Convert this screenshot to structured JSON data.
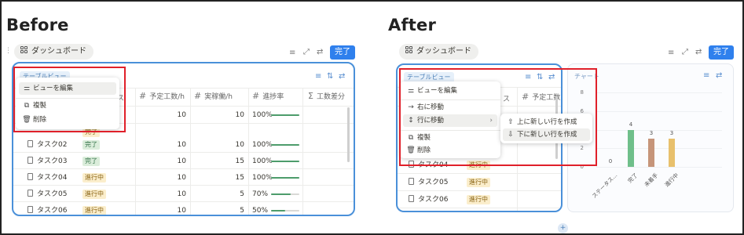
{
  "before": {
    "heading": "Before",
    "dashboard_label": "ダッシュボード",
    "done_label": "完了",
    "view_chip": "テーブルビュー",
    "columns": [
      "ス",
      "予定工数/h",
      "実稼働/h",
      "進捗率",
      "工数差分"
    ],
    "rows": [
      {
        "name": "タスク02",
        "status": "完了",
        "status_kind": "done",
        "planned": "10",
        "actual": "10",
        "progress_text": "100%",
        "progress": 1.0
      },
      {
        "name": "タスク03",
        "status": "完了",
        "status_kind": "done",
        "planned": "10",
        "actual": "15",
        "progress_text": "100%",
        "progress": 1.0
      },
      {
        "name": "タスク04",
        "status": "進行中",
        "status_kind": "prog",
        "planned": "10",
        "actual": "15",
        "progress_text": "100%",
        "progress": 1.0
      },
      {
        "name": "タスク05",
        "status": "進行中",
        "status_kind": "prog",
        "planned": "10",
        "actual": "5",
        "progress_text": "70%",
        "progress": 0.7
      },
      {
        "name": "タスク06",
        "status": "進行中",
        "status_kind": "prog",
        "planned": "10",
        "actual": "5",
        "progress_text": "50%",
        "progress": 0.5
      }
    ],
    "first_row_values": {
      "planned": "10",
      "actual": "10",
      "progress_text": "100%",
      "progress": 1.0
    },
    "menu": {
      "edit_view": "ビューを編集",
      "duplicate": "複製",
      "delete": "削除"
    }
  },
  "after": {
    "heading": "After",
    "dashboard_label": "ダッシュボード",
    "done_label": "完了",
    "view_chip": "テーブルビュー",
    "columns": [
      "ス",
      "予定工数"
    ],
    "rows": [
      {
        "name": "タスク04",
        "status": "進行中",
        "status_kind": "prog"
      },
      {
        "name": "タスク05",
        "status": "進行中",
        "status_kind": "prog"
      },
      {
        "name": "タスク06",
        "status": "進行中",
        "status_kind": "prog"
      }
    ],
    "menu": {
      "edit_view": "ビューを編集",
      "move_right": "右に移動",
      "move_row": "行に移動",
      "duplicate": "複製",
      "delete": "削除"
    },
    "submenu": {
      "new_row_above": "上に新しい行を作成",
      "new_row_below": "下に新しい行を作成"
    },
    "chart_title": "チャート",
    "add_button": "+"
  },
  "chart_data": {
    "type": "bar",
    "title": "",
    "categories": [
      "ステータス...",
      "完了",
      "未着手",
      "進行中"
    ],
    "values": [
      0,
      4,
      3,
      3
    ],
    "value_labels": [
      "0",
      "4",
      "3",
      "3"
    ],
    "colors": [
      "#cccccc",
      "#6fbf8a",
      "#c6957a",
      "#e8c06c"
    ],
    "yticks": [
      "0",
      "2",
      "4",
      "6",
      "8"
    ],
    "ylim": [
      0,
      8
    ],
    "grid": true
  },
  "colors": {
    "accent": "#2f80ed",
    "panel_border": "#4a90d9",
    "highlight": "#e0202a"
  }
}
